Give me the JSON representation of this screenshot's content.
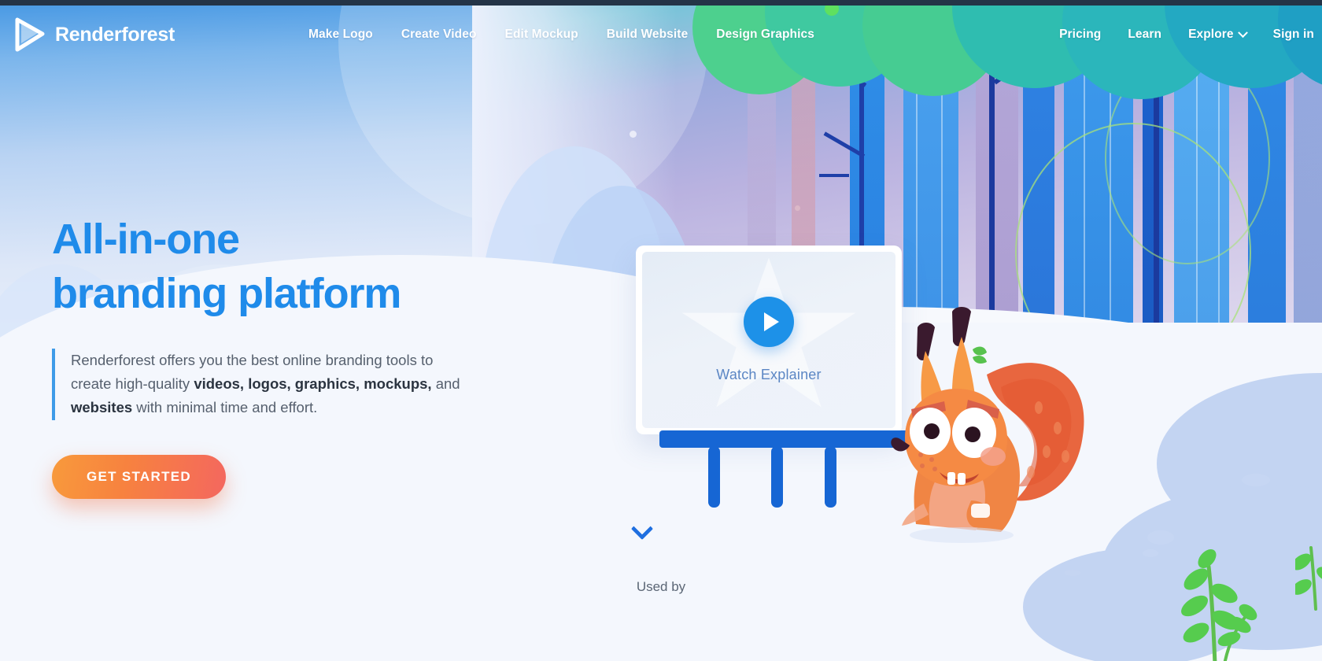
{
  "site": {
    "brand": "Renderforest",
    "logo_icon": "play-triangle-icon"
  },
  "nav": {
    "center_links": [
      {
        "label": "Make Logo",
        "name": "nav-make-logo"
      },
      {
        "label": "Create Video",
        "name": "nav-create-video"
      },
      {
        "label": "Edit Mockup",
        "name": "nav-edit-mockup"
      },
      {
        "label": "Build Website",
        "name": "nav-build-website"
      },
      {
        "label": "Design Graphics",
        "name": "nav-design-graphics"
      }
    ],
    "right_links": [
      {
        "label": "Pricing",
        "name": "nav-pricing",
        "caret": false
      },
      {
        "label": "Learn",
        "name": "nav-learn",
        "caret": false
      },
      {
        "label": "Explore",
        "name": "nav-explore",
        "caret": true
      },
      {
        "label": "Sign in",
        "name": "nav-sign-in",
        "caret": false
      }
    ],
    "caret_icon": "chevron-down-icon"
  },
  "hero": {
    "headline_line1": "All-in-one",
    "headline_line2": "branding platform",
    "paragraph": {
      "part1": "Renderforest offers you the best online branding tools to create high-quality ",
      "bold1": "videos, logos, graphics, mockups,",
      "part2": " and ",
      "bold2": "websites",
      "part3": " with minimal time and effort."
    },
    "cta_label": "GET STARTED"
  },
  "video_card": {
    "play_icon": "play-button-icon",
    "label": "Watch Explainer"
  },
  "footer_area": {
    "scroll_icon": "chevron-down-icon",
    "used_by_label": "Used by"
  },
  "colors": {
    "headline_blue": "#1f8bea",
    "cta_gradient_from": "#f89a3c",
    "cta_gradient_to": "#f4675f",
    "play_blue": "#1d91e8",
    "easel_blue": "#1666d4",
    "accent_bar": "#3e9be8",
    "top_strip": "#243447",
    "watch_label": "#5b86c4"
  }
}
